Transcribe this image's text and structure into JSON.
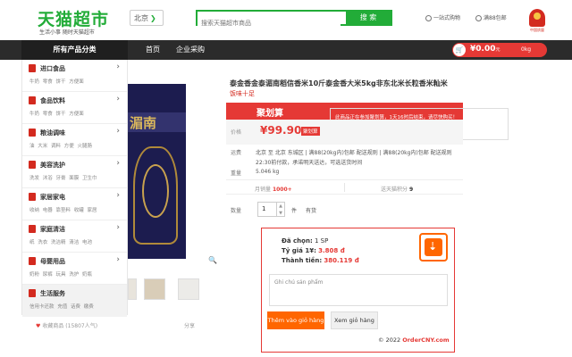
{
  "header": {
    "logo_text": "天猫超市",
    "logo_slogan": "生活小事 随时天猫超市",
    "city": "北京",
    "search_placeholder": "搜索天猫超市商品",
    "search_button": "搜 索",
    "quick_links": [
      "一站式购物",
      "满88包邮"
    ],
    "emblem_text": "中国质量"
  },
  "navbar": {
    "all_categories": "所有产品分类",
    "items": [
      "首页",
      "企业采购"
    ],
    "cart_amount": "¥0.00",
    "cart_unit_weight": "0kg",
    "cart_currency_suffix": "元"
  },
  "sidebar": {
    "categories": [
      {
        "name": "进口食品",
        "subs": "牛奶 零食 饼干 方便面"
      },
      {
        "name": "食品饮料",
        "subs": "牛奶 零食 饼干 方便面"
      },
      {
        "name": "粮油调味",
        "subs": "油 大米 调料 方便 火腿肠"
      },
      {
        "name": "美容洗护",
        "subs": "洗发 沐浴 牙膏 面膜 卫生巾"
      },
      {
        "name": "家居家电",
        "subs": "收纳 电器 靠垫料 收罐 家居"
      },
      {
        "name": "家庭清洁",
        "subs": "纸 洗衣 洗洁精 清洁 电池"
      },
      {
        "name": "母婴用品",
        "subs": "奶粉 尿裤 玩具 洗护 奶瓶"
      },
      {
        "name": "生活服务",
        "subs": "信用卡还款 充值 话费 缴费"
      }
    ]
  },
  "product": {
    "image_text": "湄南",
    "favorite_label": "收藏商品 (15807人气)",
    "share_label": "分享",
    "title": "泰金香金泰湄南稻信香米10斤泰金香大米5kg非东北米长粒香米籼米",
    "subtitle": "饭味十足",
    "promo_label": "聚划算",
    "promo_note": "此商品正在参加聚划算，1天16时后结束，请尽快购买！",
    "price_label": "价格",
    "price_value": "¥99.90",
    "price_tag": "聚划算",
    "delivery_label": "运费",
    "delivery_value": "北京 至 北京 东城区 | 满88(20kg内)包邮 配送规则 | 满88(20kg内)包邮 配送规则",
    "delivery_note": "22:30前付款，承诺明天送达，可选送货时间",
    "weight_label": "重量",
    "weight_value": "5.046 kg",
    "monthly_sales_label": "月销量",
    "monthly_sales_value": "1000+",
    "points_label": "送天猫积分",
    "points_value": "9",
    "qty_label": "数量",
    "qty_value": "1",
    "qty_unit": "件",
    "stock_label": "有货"
  },
  "order_panel": {
    "selected_label": "Đã chọn:",
    "selected_value": "1 SP",
    "rate_label": "Tỷ giá 1¥:",
    "rate_value": "3.808 đ",
    "total_label": "Thành tiền:",
    "total_value": "380.119 đ",
    "note_placeholder": "Ghi chú sản phẩm",
    "add_button": "Thêm vào giỏ hàng",
    "view_button": "Xem giỏ hàng",
    "copyright": "© 2022",
    "brand": "OrderCNY.com"
  }
}
